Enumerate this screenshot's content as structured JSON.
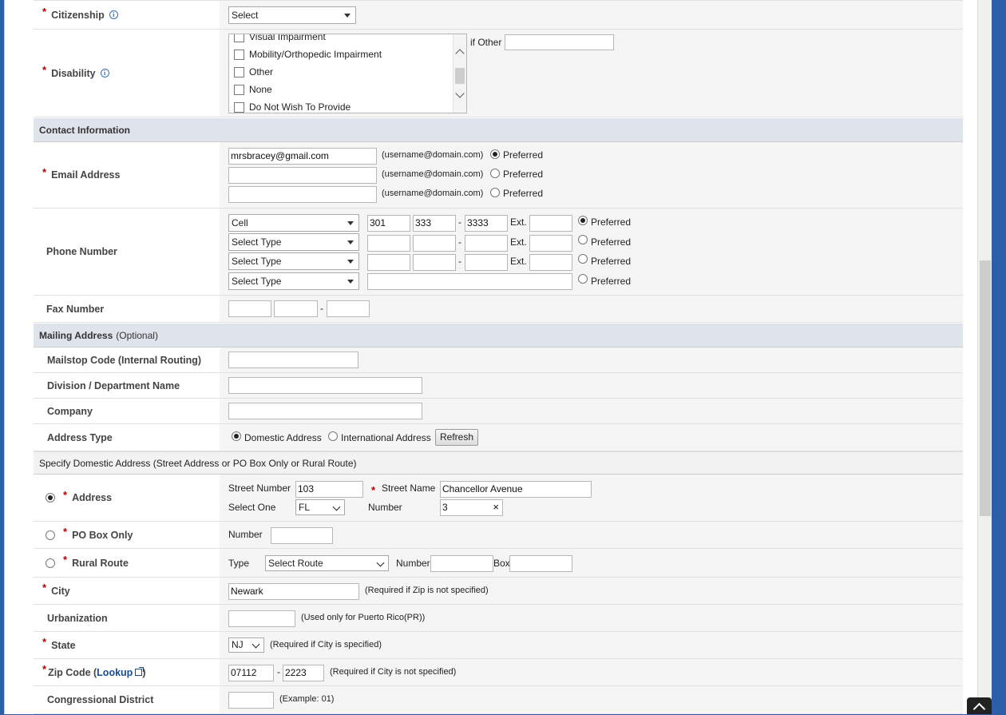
{
  "citizenship": {
    "label": "Citizenship",
    "value": "Select"
  },
  "disability": {
    "label": "Disability",
    "options": [
      "Visual Impairment",
      "Mobility/Orthopedic Impairment",
      "Other",
      "None",
      "Do Not Wish To Provide"
    ],
    "if_other_label": "if Other"
  },
  "contact_section": {
    "title": "Contact Information"
  },
  "email": {
    "label": "Email Address",
    "values": [
      "mrsbracey@gmail.com",
      "",
      ""
    ],
    "hint": "(username@domain.com)",
    "preferred_label": "Preferred",
    "preferred_index": 0
  },
  "phone": {
    "label": "Phone Number",
    "rows": [
      {
        "type": "Cell",
        "area": "301",
        "prefix": "333",
        "line": "3333",
        "ext": ""
      },
      {
        "type": "Select Type",
        "area": "",
        "prefix": "",
        "line": "",
        "ext": ""
      },
      {
        "type": "Select Type",
        "area": "",
        "prefix": "",
        "line": "",
        "ext": ""
      },
      {
        "type": "Select Type",
        "international": ""
      }
    ],
    "ext_label": "Ext.",
    "dash": "-",
    "preferred_label": "Preferred",
    "preferred_index": 0
  },
  "fax": {
    "label": "Fax Number",
    "dash": "-"
  },
  "mailing_section": {
    "title": "Mailing Address",
    "optional": "(Optional)"
  },
  "mailstop": {
    "label": "Mailstop Code (Internal Routing)",
    "value": ""
  },
  "division": {
    "label": "Division / Department Name",
    "value": ""
  },
  "company": {
    "label": "Company",
    "value": ""
  },
  "address_type": {
    "label": "Address Type",
    "domestic": "Domestic Address",
    "international": "International Address",
    "selected": "domestic",
    "refresh_label": "Refresh"
  },
  "domestic_section": {
    "title": "Specify Domestic Address (Street Address or PO Box Only or Rural Route)"
  },
  "address": {
    "label": "Address",
    "street_number_label": "Street Number",
    "street_number": "103",
    "street_name_label": "Street Name",
    "street_name": "Chancellor Avenue",
    "select_one_label": "Select One",
    "select_one_value": "FL",
    "number_label": "Number",
    "number_value": "3",
    "clear_glyph": "×"
  },
  "po_box": {
    "label": "PO Box Only",
    "number_label": "Number",
    "value": ""
  },
  "rural_route": {
    "label": "Rural Route",
    "type_label": "Type",
    "type_value": "Select Route",
    "number_label": "Number",
    "box_label": "Box"
  },
  "city": {
    "label": "City",
    "value": "Newark",
    "hint": "(Required if Zip is not specified)"
  },
  "urbanization": {
    "label": "Urbanization",
    "value": "",
    "hint": "(Used only for Puerto Rico(PR))"
  },
  "state": {
    "label": "State",
    "value": "NJ",
    "hint": "(Required if City is specified)"
  },
  "zip": {
    "label_pre": "Zip Code (",
    "lookup": "Lookup",
    "label_post": " )",
    "zip5": "07112",
    "zip4": "2223",
    "dash": "-",
    "hint": "(Required if City is not specified)"
  },
  "congressional": {
    "label": "Congressional District",
    "value": "",
    "hint": "(Example: 01)"
  }
}
